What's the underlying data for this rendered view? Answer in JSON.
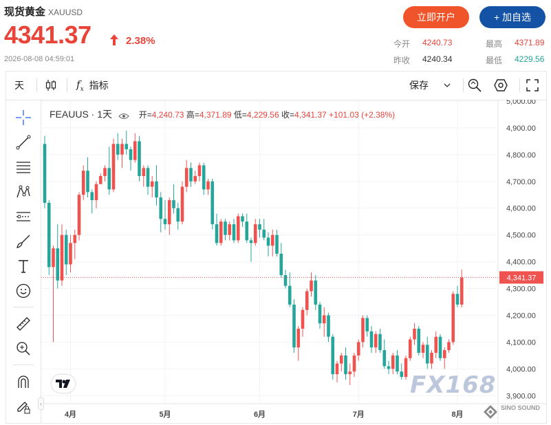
{
  "header": {
    "title": "现货黄金",
    "symbol": "XAUUSD",
    "price": "4341.37",
    "change_pct": "2.38%",
    "timestamp": "2026-08-08 04:59:01",
    "open_account_label": "立即开户",
    "add_watch_label": "+ 加自选"
  },
  "stats": {
    "open_label": "今开",
    "open_value": "4240.73",
    "high_label": "最高",
    "high_value": "4371.89",
    "prev_label": "昨收",
    "prev_value": "4240.34",
    "low_label": "最低",
    "low_value": "4229.56"
  },
  "toolbar": {
    "interval_label": "天",
    "indicator_label": "指标",
    "save_label": "保存"
  },
  "legend": {
    "symbol": "FEAUUS · 1天",
    "open_label": "开",
    "open_value": "4,240.73",
    "high_label": "高",
    "high_value": "4,371.89",
    "low_label": "低",
    "low_value": "4,229.56",
    "close_label": "收",
    "close_value": "4,341.37",
    "change": "+101.03 (+2.38%)"
  },
  "colors": {
    "up": "#ef5350",
    "down": "#26a69a",
    "accent": "#e8443a",
    "brand_blue": "#1452a6",
    "brand_orange": "#f0542b"
  },
  "watermark": "FX168",
  "logo_text": "SINO SOUND",
  "chart_data": {
    "type": "candlestick",
    "y_ticks": [
      "5,000.00",
      "4,900.00",
      "4,800.00",
      "4,700.00",
      "4,600.00",
      "4,500.00",
      "4,400.00",
      "4,300.00",
      "4,200.00",
      "4,100.00",
      "4,000.00",
      "3,900.00"
    ],
    "ylim": [
      3870,
      5005
    ],
    "x_ticks": [
      {
        "label": "4月",
        "index": 6
      },
      {
        "label": "5月",
        "index": 28
      },
      {
        "label": "6月",
        "index": 50
      },
      {
        "label": "7月",
        "index": 73
      },
      {
        "label": "8月",
        "index": 96
      }
    ],
    "last_price_label": "4,341.37",
    "last_price": 4341.37,
    "ohlc": [
      [
        4840,
        4870,
        4600,
        4620
      ],
      [
        4620,
        4630,
        4350,
        4380
      ],
      [
        4380,
        4460,
        4100,
        4450
      ],
      [
        4450,
        4540,
        4300,
        4330
      ],
      [
        4330,
        4540,
        4310,
        4500
      ],
      [
        4500,
        4520,
        4350,
        4390
      ],
      [
        4390,
        4500,
        4360,
        4470
      ],
      [
        4470,
        4520,
        4410,
        4500
      ],
      [
        4500,
        4660,
        4480,
        4650
      ],
      [
        4650,
        4760,
        4630,
        4740
      ],
      [
        4740,
        4790,
        4640,
        4660
      ],
      [
        4660,
        4670,
        4580,
        4630
      ],
      [
        4630,
        4700,
        4600,
        4690
      ],
      [
        4690,
        4730,
        4690,
        4720
      ],
      [
        4720,
        4760,
        4700,
        4750
      ],
      [
        4750,
        4830,
        4650,
        4670
      ],
      [
        4670,
        4860,
        4660,
        4840
      ],
      [
        4840,
        4880,
        4780,
        4800
      ],
      [
        4800,
        4860,
        4750,
        4840
      ],
      [
        4840,
        4890,
        4800,
        4820
      ],
      [
        4820,
        4830,
        4740,
        4780
      ],
      [
        4780,
        4880,
        4770,
        4850
      ],
      [
        4850,
        4870,
        4700,
        4720
      ],
      [
        4720,
        4760,
        4680,
        4750
      ],
      [
        4750,
        4760,
        4650,
        4680
      ],
      [
        4680,
        4720,
        4640,
        4700
      ],
      [
        4700,
        4760,
        4610,
        4640
      ],
      [
        4640,
        4660,
        4510,
        4560
      ],
      [
        4560,
        4630,
        4520,
        4540
      ],
      [
        4540,
        4640,
        4500,
        4630
      ],
      [
        4630,
        4690,
        4580,
        4600
      ],
      [
        4600,
        4620,
        4520,
        4550
      ],
      [
        4550,
        4700,
        4540,
        4680
      ],
      [
        4680,
        4780,
        4660,
        4750
      ],
      [
        4750,
        4770,
        4680,
        4700
      ],
      [
        4700,
        4740,
        4690,
        4720
      ],
      [
        4720,
        4770,
        4700,
        4760
      ],
      [
        4760,
        4770,
        4650,
        4670
      ],
      [
        4670,
        4710,
        4650,
        4700
      ],
      [
        4700,
        4710,
        4520,
        4540
      ],
      [
        4540,
        4580,
        4460,
        4470
      ],
      [
        4470,
        4560,
        4460,
        4550
      ],
      [
        4550,
        4560,
        4480,
        4500
      ],
      [
        4500,
        4550,
        4480,
        4540
      ],
      [
        4540,
        4560,
        4470,
        4480
      ],
      [
        4480,
        4580,
        4470,
        4570
      ],
      [
        4570,
        4580,
        4530,
        4550
      ],
      [
        4550,
        4580,
        4470,
        4480
      ],
      [
        4480,
        4490,
        4400,
        4470
      ],
      [
        4470,
        4560,
        4460,
        4540
      ],
      [
        4540,
        4560,
        4490,
        4520
      ],
      [
        4520,
        4560,
        4480,
        4490
      ],
      [
        4490,
        4510,
        4420,
        4460
      ],
      [
        4460,
        4520,
        4420,
        4500
      ],
      [
        4500,
        4520,
        4420,
        4430
      ],
      [
        4430,
        4470,
        4340,
        4350
      ],
      [
        4350,
        4370,
        4300,
        4310
      ],
      [
        4310,
        4360,
        4230,
        4240
      ],
      [
        4240,
        4260,
        4060,
        4080
      ],
      [
        4080,
        4160,
        4030,
        4150
      ],
      [
        4150,
        4230,
        4120,
        4220
      ],
      [
        4220,
        4300,
        4200,
        4290
      ],
      [
        4290,
        4360,
        4270,
        4330
      ],
      [
        4330,
        4350,
        4220,
        4240
      ],
      [
        4240,
        4250,
        4150,
        4170
      ],
      [
        4170,
        4230,
        4120,
        4200
      ],
      [
        4200,
        4210,
        4100,
        4120
      ],
      [
        4120,
        4130,
        3960,
        3980
      ],
      [
        3980,
        4030,
        3950,
        4020
      ],
      [
        4020,
        4060,
        3990,
        4050
      ],
      [
        4050,
        4080,
        3960,
        3980
      ],
      [
        3980,
        4020,
        3940,
        3990
      ],
      [
        3990,
        4060,
        3970,
        4050
      ],
      [
        4050,
        4110,
        4030,
        4100
      ],
      [
        4100,
        4200,
        4080,
        4190
      ],
      [
        4190,
        4200,
        4120,
        4140
      ],
      [
        4140,
        4160,
        4060,
        4080
      ],
      [
        4080,
        4140,
        4060,
        4130
      ],
      [
        4130,
        4150,
        4060,
        4070
      ],
      [
        4070,
        4110,
        4000,
        4010
      ],
      [
        4010,
        4030,
        3980,
        4000
      ],
      [
        4000,
        4060,
        3980,
        4050
      ],
      [
        4050,
        4070,
        3980,
        3990
      ],
      [
        3990,
        4020,
        3960,
        3970
      ],
      [
        3970,
        4050,
        3960,
        4040
      ],
      [
        4040,
        4120,
        4030,
        4110
      ],
      [
        4110,
        4170,
        4090,
        4150
      ],
      [
        4150,
        4160,
        4050,
        4060
      ],
      [
        4060,
        4100,
        4040,
        4090
      ],
      [
        4090,
        4120,
        4000,
        4020
      ],
      [
        4020,
        4070,
        4000,
        4060
      ],
      [
        4060,
        4140,
        4040,
        4120
      ],
      [
        4120,
        4130,
        4030,
        4040
      ],
      [
        4040,
        4080,
        4000,
        4070
      ],
      [
        4070,
        4110,
        4060,
        4100
      ],
      [
        4100,
        4290,
        4090,
        4280
      ],
      [
        4280,
        4310,
        4230,
        4240
      ],
      [
        4240,
        4371,
        4229,
        4341
      ]
    ]
  }
}
